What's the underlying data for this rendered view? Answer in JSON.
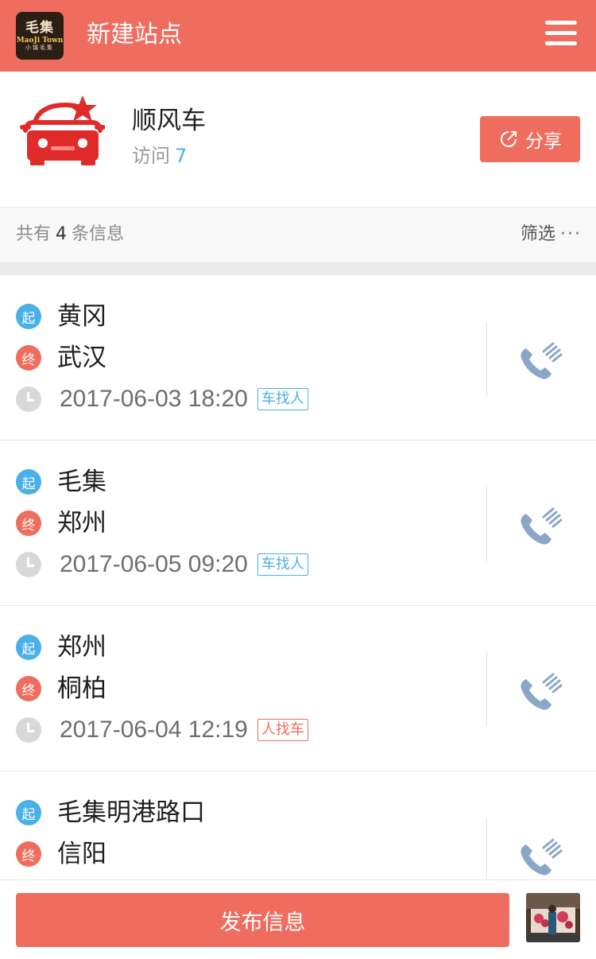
{
  "header": {
    "logo_main": "毛集",
    "logo_sub": "MaoJi Town",
    "logo_small": "小镇毛集",
    "title": "新建站点"
  },
  "station": {
    "name": "顺风车",
    "visits_label": "访问",
    "visits_count": "7",
    "share_label": "分享"
  },
  "summary": {
    "prefix": "共有",
    "count": "4",
    "suffix": "条信息",
    "filter_label": "筛选",
    "filter_dots": "···"
  },
  "badges": {
    "start": "起",
    "end": "终"
  },
  "rides": [
    {
      "from": "黄冈",
      "to": "武汉",
      "time": "2017-06-03 18:20",
      "tag": "车找人",
      "tag_type": "blue"
    },
    {
      "from": "毛集",
      "to": "郑州",
      "time": "2017-06-05 09:20",
      "tag": "车找人",
      "tag_type": "blue"
    },
    {
      "from": "郑州",
      "to": "桐柏",
      "time": "2017-06-04 12:19",
      "tag": "人找车",
      "tag_type": "red"
    },
    {
      "from": "毛集明港路口",
      "to": "信阳",
      "time": "",
      "tag": "",
      "tag_type": ""
    }
  ],
  "bottom": {
    "publish_label": "发布信息"
  },
  "colors": {
    "accent": "#ef6d5e",
    "start_blue": "#4ab0e8",
    "phone": "#8aa6c8"
  }
}
